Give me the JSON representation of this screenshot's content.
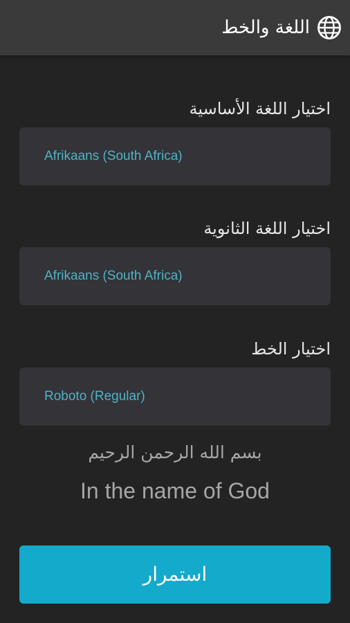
{
  "header": {
    "title": "اللغة والخط",
    "icon": "globe-icon"
  },
  "primary_language": {
    "label": "اختيار اللغة الأساسية",
    "value": "Afrikaans (South Africa)"
  },
  "secondary_language": {
    "label": "اختيار اللغة الثانوية",
    "value": "Afrikaans (South Africa)"
  },
  "font": {
    "label": "اختيار الخط",
    "value": "Roboto (Regular)"
  },
  "preview": {
    "arabic": "بسم الله الرحمن الرحيم",
    "english": "In the name of God"
  },
  "continue_button": {
    "label": "استمرار"
  },
  "colors": {
    "background": "#232323",
    "header": "#3a3a3a",
    "select_box": "#333338",
    "value_text": "#4fb3c3",
    "accent": "#13aacb"
  }
}
